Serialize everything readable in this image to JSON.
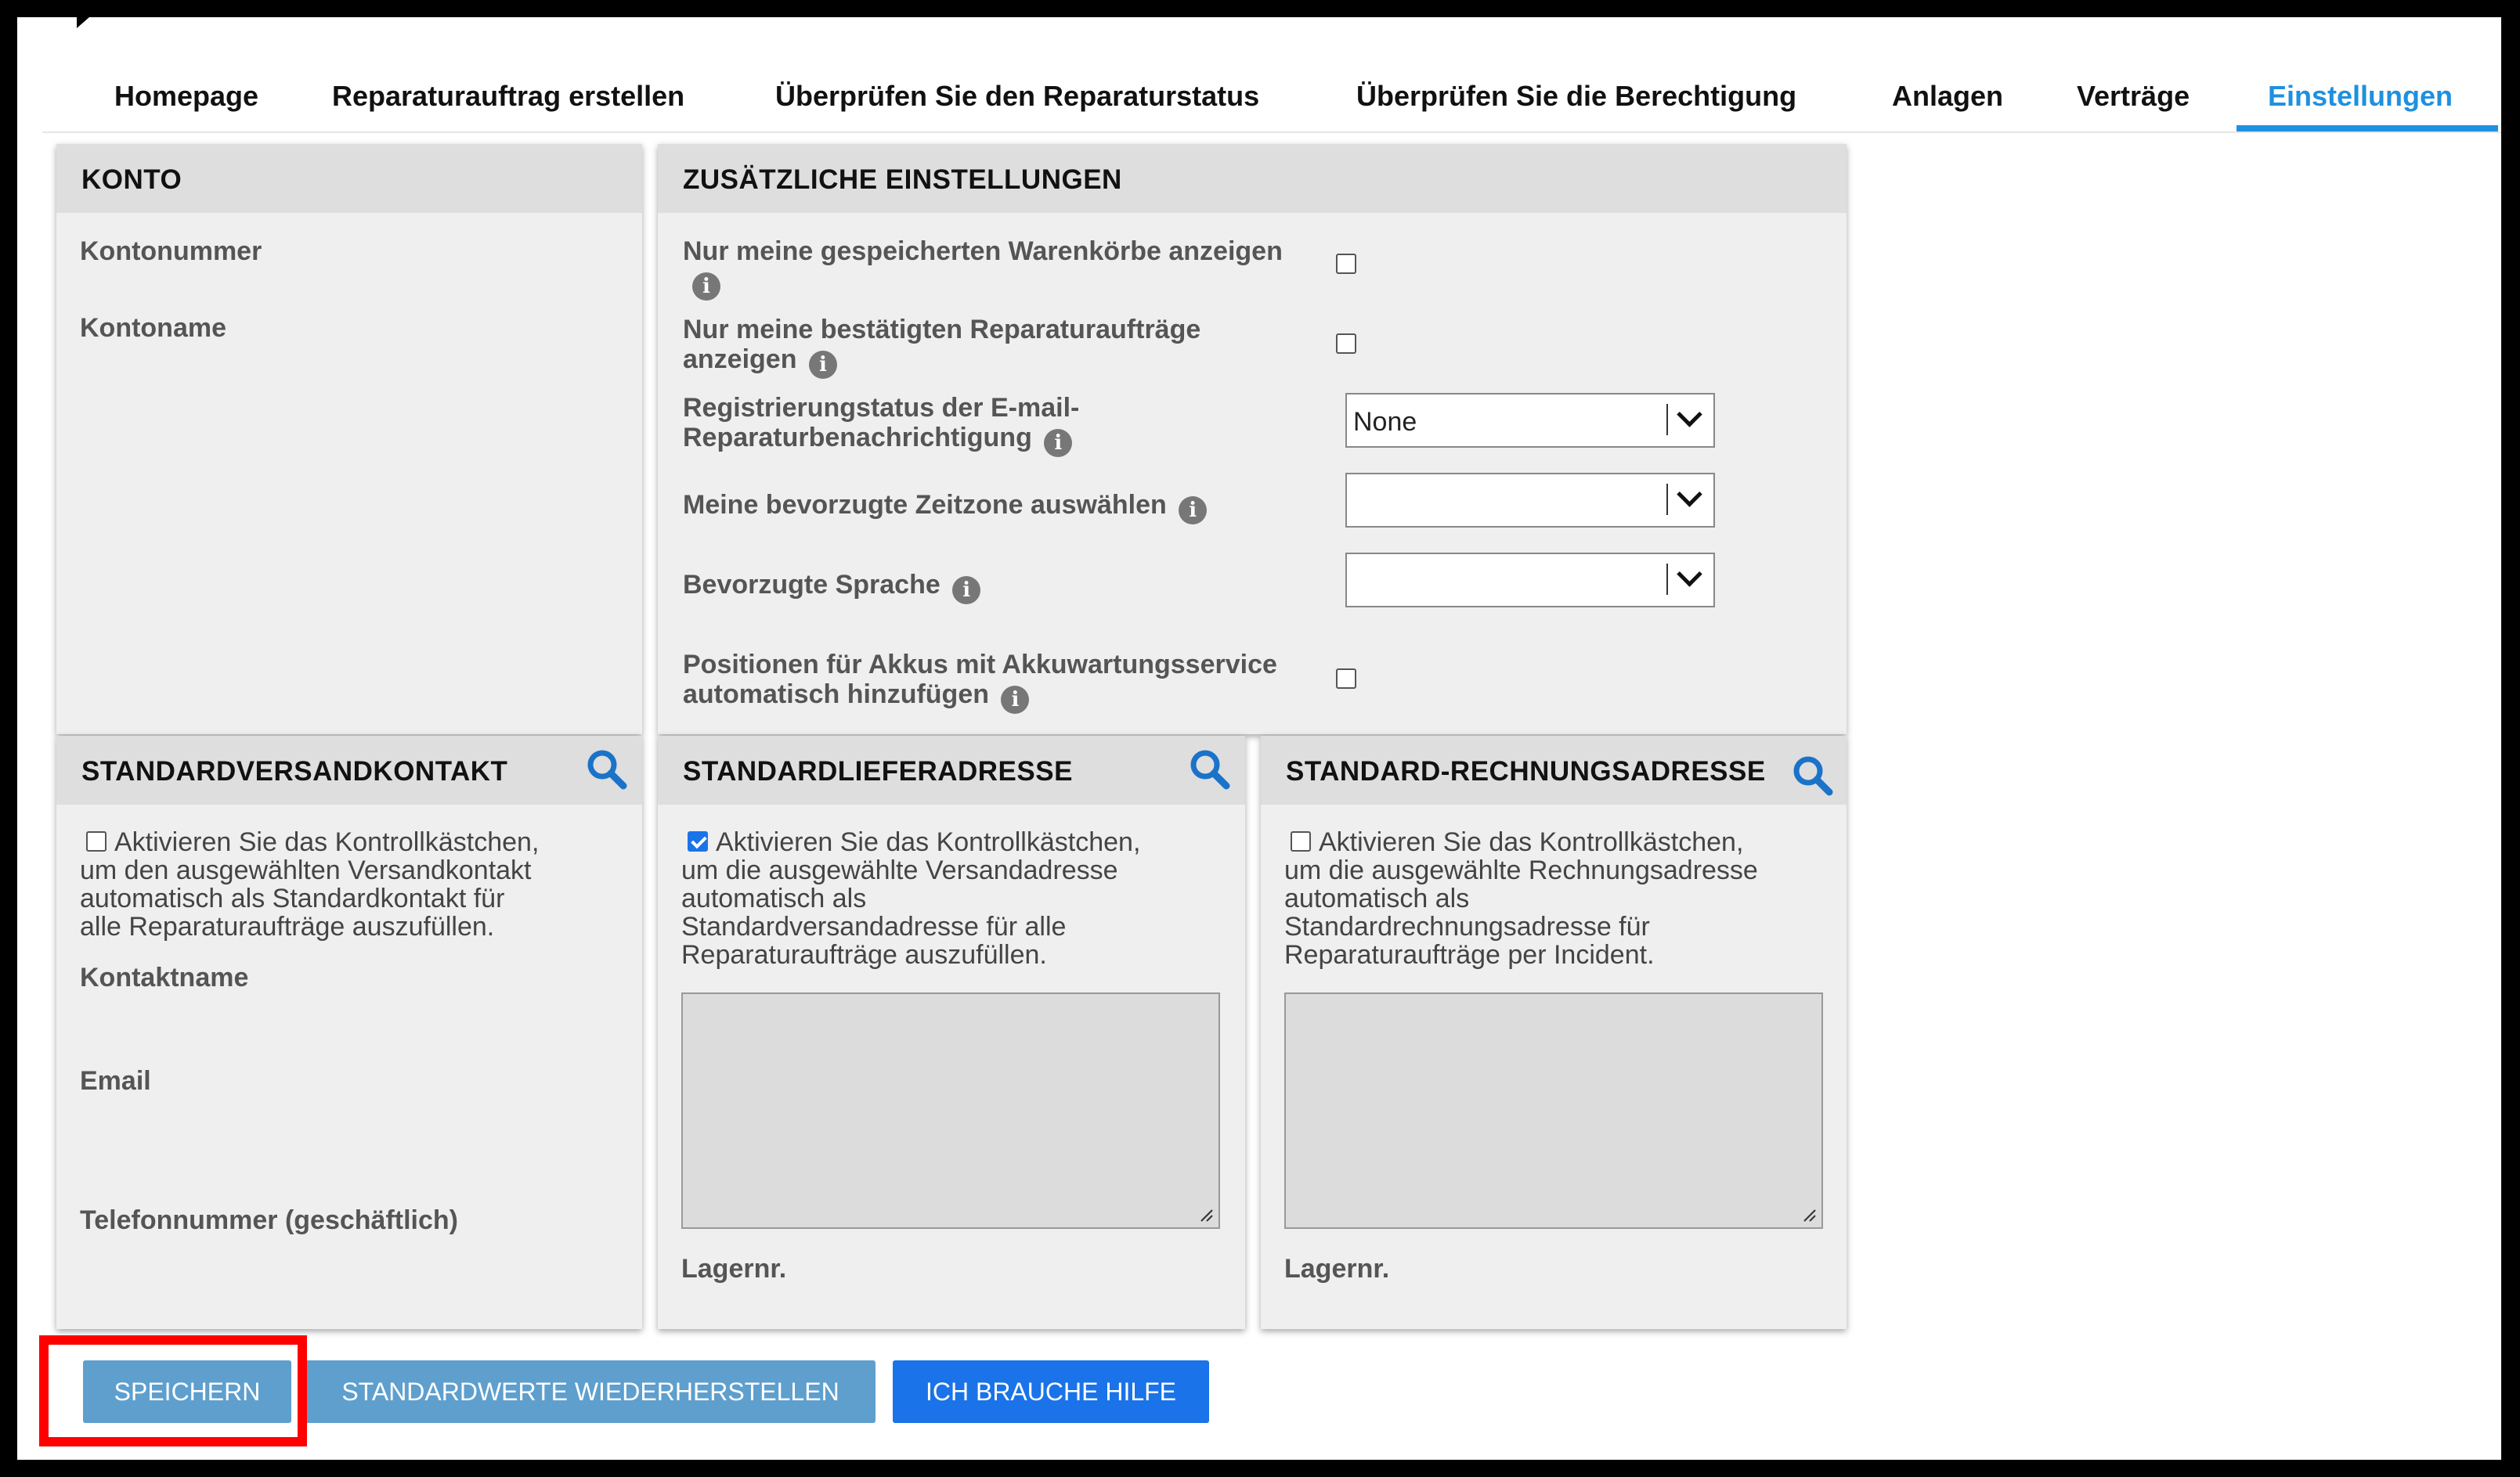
{
  "nav": {
    "items": [
      {
        "label": "Homepage"
      },
      {
        "label": "Reparaturauftrag erstellen"
      },
      {
        "label": "Überprüfen Sie den Reparaturstatus"
      },
      {
        "label": "Überprüfen Sie die Berechtigung"
      },
      {
        "label": "Anlagen"
      },
      {
        "label": "Verträge"
      },
      {
        "label": "Einstellungen",
        "active": true
      }
    ]
  },
  "konto": {
    "title": "KONTO",
    "kontonummer_label": "Kontonummer",
    "kontoname_label": "Kontoname"
  },
  "zusatz": {
    "title": "ZUSÄTZLICHE EINSTELLUNGEN",
    "warenkoerbe_label": "Nur meine gespeicherten Warenkörbe anzeigen",
    "warenkoerbe_checked": false,
    "reparaturauftraege_label_1": "Nur meine bestätigten Reparaturaufträge",
    "reparaturauftraege_label_2": "anzeigen",
    "reparaturauftraege_checked": false,
    "email_label_1": "Registrierungstatus der E-mail-",
    "email_label_2": "Reparaturbenachrichtigung",
    "email_value": "None",
    "zeitzone_label": "Meine bevorzugte Zeitzone auswählen",
    "zeitzone_value": "",
    "sprache_label": "Bevorzugte Sprache",
    "sprache_value": "",
    "akkus_label_1": "Positionen für Akkus mit Akkuwartungsservice",
    "akkus_label_2": "automatisch hinzufügen",
    "akkus_checked": false
  },
  "versandkontakt": {
    "title": "STANDARDVERSANDKONTAKT",
    "checkbox_checked": false,
    "desc_lines": [
      "Aktivieren Sie das Kontrollkästchen,",
      "um den ausgewählten Versandkontakt",
      "automatisch als Standardkontakt für",
      "alle Reparaturaufträge auszufüllen."
    ],
    "kontaktname_label": "Kontaktname",
    "email_label": "Email",
    "telefon_label": "Telefonnummer (geschäftlich)"
  },
  "lieferadresse": {
    "title": "STANDARDLIEFERADRESSE",
    "checkbox_checked": true,
    "desc_lines": [
      "Aktivieren Sie das Kontrollkästchen,",
      "um die ausgewählte Versandadresse",
      "automatisch als",
      "Standardversandadresse für alle",
      "Reparaturaufträge auszufüllen."
    ],
    "address_value": "",
    "lagernr_label": "Lagernr."
  },
  "rechnungsadresse": {
    "title": "STANDARD-RECHNUNGSADRESSE",
    "checkbox_checked": false,
    "desc_lines": [
      "Aktivieren Sie das Kontrollkästchen,",
      "um die ausgewählte Rechnungsadresse",
      "automatisch als",
      "Standardrechnungsadresse für",
      "Reparaturaufträge per Incident."
    ],
    "address_value": "",
    "lagernr_label": "Lagernr."
  },
  "buttons": {
    "save": "SPEICHERN",
    "reset": "STANDARDWERTE WIEDERHERSTELLEN",
    "help": "ICH BRAUCHE HILFE"
  },
  "colors": {
    "accent": "#1e90e0",
    "button_primary": "#5e9fce",
    "button_help": "#1a73e8",
    "highlight": "#ff0000"
  }
}
